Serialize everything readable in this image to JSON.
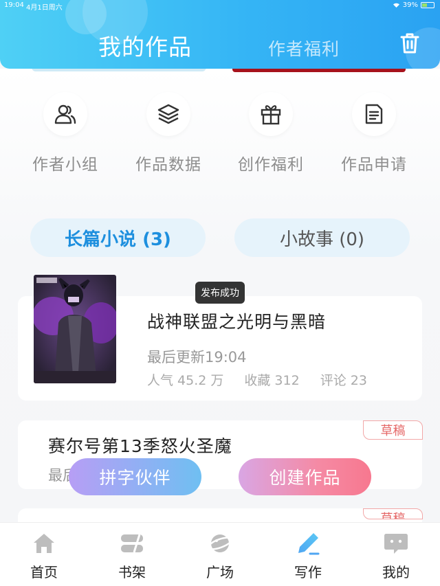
{
  "status_bar": {
    "time": "19:04",
    "date": "4月1日周六",
    "battery": "39%"
  },
  "header": {
    "tab_works": "我的作品",
    "tab_benefits": "作者福利"
  },
  "tools": [
    {
      "label": "作者小组",
      "icon": "group-icon"
    },
    {
      "label": "作品数据",
      "icon": "layers-icon"
    },
    {
      "label": "创作福利",
      "icon": "gift-icon"
    },
    {
      "label": "作品申请",
      "icon": "document-icon"
    }
  ],
  "segments": {
    "novel": "长篇小说 (3)",
    "story": "小故事 (0)"
  },
  "works": [
    {
      "title": "战神联盟之光明与黑暗",
      "updated": "最后更新19:04",
      "popularity": "人气 45.2 万",
      "favorites": "收藏 312",
      "comments": "评论 23"
    },
    {
      "title": "赛尔号第13季怒火圣魔",
      "updated": "最后",
      "badge": "草稿"
    },
    {
      "badge": "草稿"
    }
  ],
  "toast": "发布成功",
  "floating": {
    "partner": "拼字伙伴",
    "create": "创建作品"
  },
  "tabbar": [
    {
      "label": "首页",
      "icon": "home-icon"
    },
    {
      "label": "书架",
      "icon": "bookshelf-icon"
    },
    {
      "label": "广场",
      "icon": "planet-icon"
    },
    {
      "label": "写作",
      "icon": "pen-icon"
    },
    {
      "label": "我的",
      "icon": "chat-bubble-icon"
    }
  ],
  "colors": {
    "header": "#35b5f5",
    "active_tab": "#1d8fde",
    "draft": "#e56767"
  }
}
